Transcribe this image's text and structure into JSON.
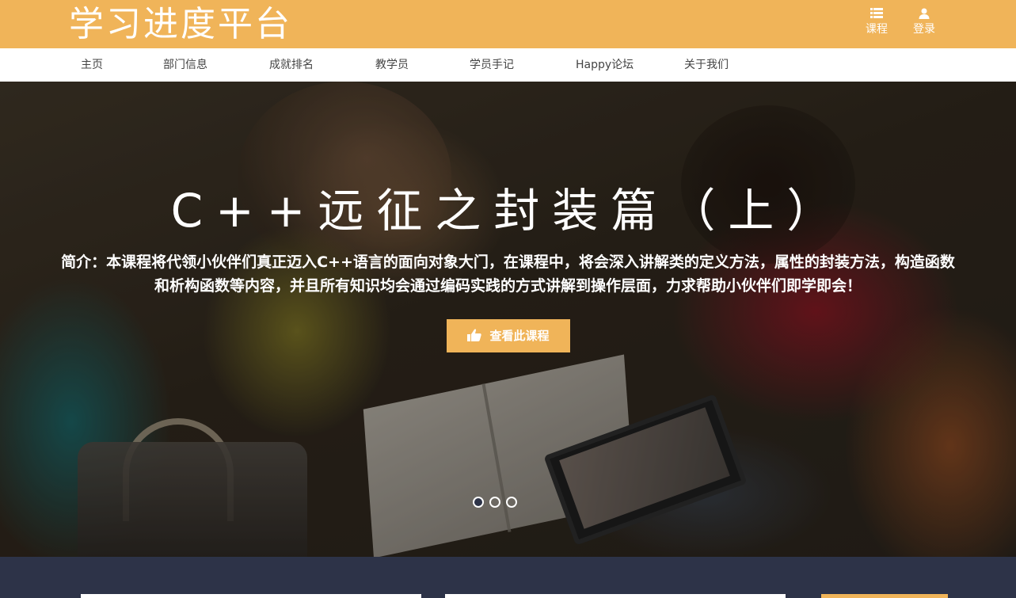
{
  "header": {
    "brand": "学习进度平台",
    "course_label": "课程",
    "login_label": "登录",
    "background_color": "#f0b459"
  },
  "nav": {
    "items": [
      {
        "label": "主页"
      },
      {
        "label": "部门信息"
      },
      {
        "label": "成就排名"
      },
      {
        "label": "教学员"
      },
      {
        "label": "学员手记"
      },
      {
        "label": "Happy论坛"
      },
      {
        "label": "关于我们"
      }
    ]
  },
  "hero": {
    "title": "C++远征之封装篇（上）",
    "description": "简介：本课程将代领小伙伴们真正迈入C++语言的面向对象大门，在课程中，将会深入讲解类的定义方法，属性的封装方法，构造函数和析构函数等内容，并且所有知识均会通过编码实践的方式讲解到操作层面，力求帮助小伙伴们即学即会！",
    "button_label": "查看此课程",
    "button_icon": "thumbs-up-icon",
    "slide_count": 3,
    "active_slide": 1
  },
  "colors": {
    "accent": "#f0b459",
    "footer": "#2d3348",
    "nav_text": "#444444"
  }
}
